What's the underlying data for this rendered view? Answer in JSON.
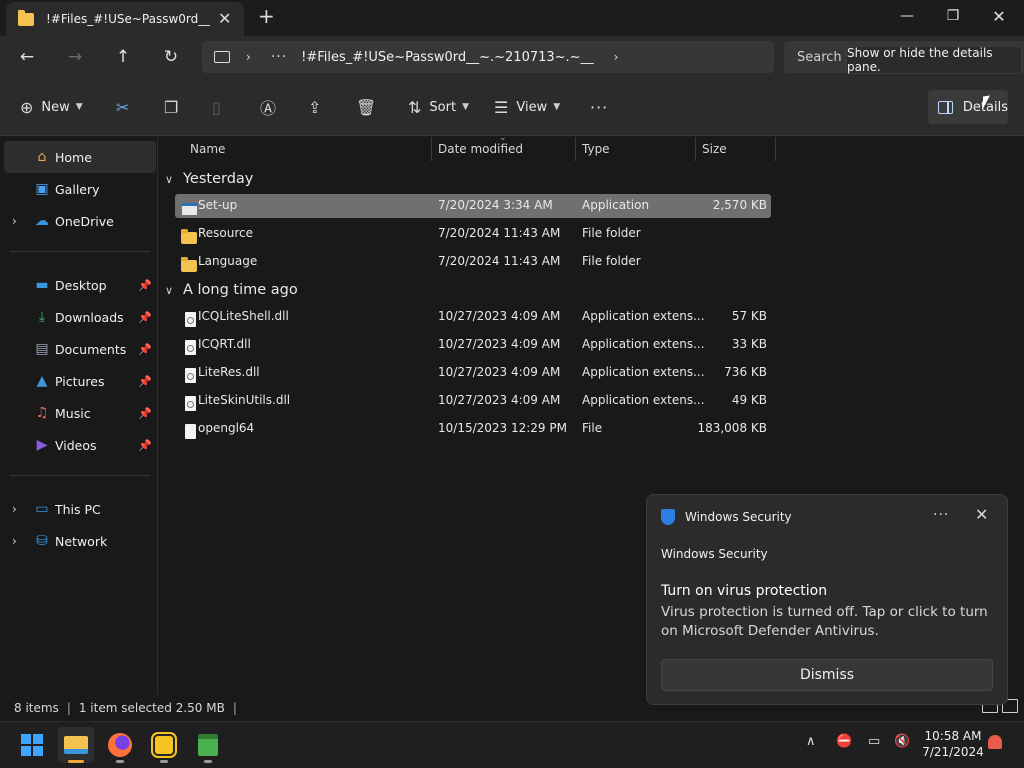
{
  "window": {
    "tab_title": "!#Files_#!USe~Passw0rd__~.~210713~.~__",
    "new_tab": "+",
    "tab_close": "✕",
    "minimize": "—",
    "maximize": "❐",
    "close": "✕"
  },
  "nav": {
    "back": "←",
    "forward": "→",
    "up": "↑",
    "refresh": "↻"
  },
  "address": {
    "chevron": "›",
    "ellipsis": "···",
    "path": "!#Files_#!USe~Passw0rd__~.~210713~.~__",
    "end_chevron": "›"
  },
  "search": {
    "placeholder": "Search !"
  },
  "tooltip": "Show or hide the details pane.",
  "toolbar": {
    "new_label": "New",
    "sort_label": "Sort",
    "view_label": "View",
    "more_label": "···",
    "details_label": "Details"
  },
  "sidebar": {
    "items": [
      {
        "label": "Home",
        "icon": "home-icon",
        "color": "#f0a35c"
      },
      {
        "label": "Gallery",
        "icon": "gallery-icon",
        "color": "#4aa3f0"
      },
      {
        "label": "OneDrive",
        "icon": "onedrive-icon",
        "color": "#3a96dd"
      },
      {
        "label": "Desktop",
        "icon": "desktop-icon",
        "color": "#3a96dd"
      },
      {
        "label": "Downloads",
        "icon": "downloads-icon",
        "color": "#3fbf6f"
      },
      {
        "label": "Documents",
        "icon": "documents-icon",
        "color": "#9aa4b2"
      },
      {
        "label": "Pictures",
        "icon": "pictures-icon",
        "color": "#3a96dd"
      },
      {
        "label": "Music",
        "icon": "music-icon",
        "color": "#e86a5c"
      },
      {
        "label": "Videos",
        "icon": "videos-icon",
        "color": "#8c5ae0"
      },
      {
        "label": "This PC",
        "icon": "this-pc-icon",
        "color": "#3a96dd"
      },
      {
        "label": "Network",
        "icon": "network-icon",
        "color": "#3a96dd"
      }
    ]
  },
  "columns": {
    "name": "Name",
    "date": "Date modified",
    "type": "Type",
    "size": "Size"
  },
  "groups": {
    "recent": "Yesterday",
    "old": "A long time ago"
  },
  "files": [
    {
      "name": "Set-up",
      "date": "7/20/2024 3:34 AM",
      "type": "Application",
      "size": "2,570 KB",
      "icon": "app-icon"
    },
    {
      "name": "Resource",
      "date": "7/20/2024 11:43 AM",
      "type": "File folder",
      "size": "",
      "icon": "folder-icon"
    },
    {
      "name": "Language",
      "date": "7/20/2024 11:43 AM",
      "type": "File folder",
      "size": "",
      "icon": "folder-icon"
    },
    {
      "name": "ICQLiteShell.dll",
      "date": "10/27/2023 4:09 AM",
      "type": "Application extens...",
      "size": "57 KB",
      "icon": "dll-icon"
    },
    {
      "name": "ICQRT.dll",
      "date": "10/27/2023 4:09 AM",
      "type": "Application extens...",
      "size": "33 KB",
      "icon": "dll-icon"
    },
    {
      "name": "LiteRes.dll",
      "date": "10/27/2023 4:09 AM",
      "type": "Application extens...",
      "size": "736 KB",
      "icon": "dll-icon"
    },
    {
      "name": "LiteSkinUtils.dll",
      "date": "10/27/2023 4:09 AM",
      "type": "Application extens...",
      "size": "49 KB",
      "icon": "dll-icon"
    },
    {
      "name": "opengl64",
      "date": "10/15/2023 12:29 PM",
      "type": "File",
      "size": "183,008 KB",
      "icon": "file-icon"
    }
  ],
  "status": {
    "items": "8 items",
    "selected": "1 item selected  2.50 MB",
    "sep": "|"
  },
  "toast": {
    "app": "Windows Security",
    "more": "···",
    "close": "✕",
    "subtitle": "Windows Security",
    "heading": "Turn on virus protection",
    "body": "Virus protection is turned off. Tap or click to turn on Microsoft Defender Antivirus.",
    "dismiss": "Dismiss"
  },
  "taskbar": {
    "chevron_up": "∧",
    "time": "10:58 AM",
    "date": "7/21/2024"
  }
}
